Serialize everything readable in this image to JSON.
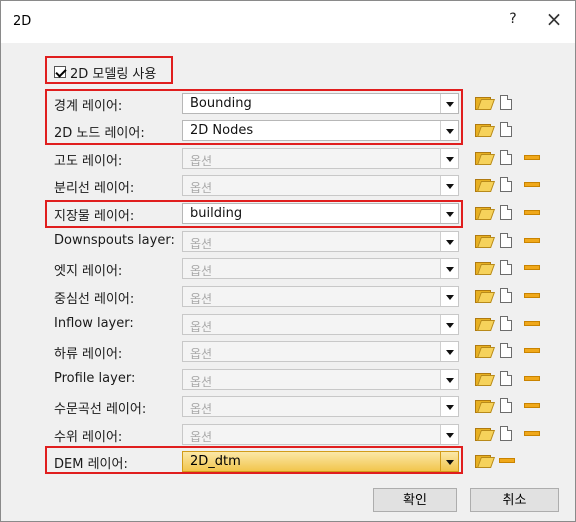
{
  "window": {
    "title": "2D",
    "help_glyph": "?",
    "close_glyph": "×"
  },
  "use_2d_modeling": {
    "label": "2D 모델링 사용",
    "checked": true
  },
  "layers": [
    {
      "label": "경계 레이어:",
      "value": "Bounding",
      "enabled": true,
      "icons": [
        "browse-icon",
        "new-layer-icon"
      ]
    },
    {
      "label": "2D 노드 레이어:",
      "value": "2D Nodes",
      "enabled": true,
      "icons": [
        "browse-icon",
        "new-layer-icon"
      ]
    },
    {
      "label": "고도 레이어:",
      "value": "옵션",
      "enabled": false,
      "icons": [
        "browse-icon",
        "new-layer-icon",
        "clear-icon"
      ]
    },
    {
      "label": "분리선 레이어:",
      "value": "옵션",
      "enabled": false,
      "icons": [
        "browse-icon",
        "new-layer-icon",
        "clear-icon"
      ]
    },
    {
      "label": "지장물 레이어:",
      "value": "building",
      "enabled": true,
      "icons": [
        "browse-icon",
        "new-layer-icon",
        "clear-icon"
      ]
    },
    {
      "label": "Downspouts layer:",
      "value": "옵션",
      "enabled": false,
      "icons": [
        "browse-icon",
        "new-layer-icon",
        "clear-icon"
      ]
    },
    {
      "label": "엣지 레이어:",
      "value": "옵션",
      "enabled": false,
      "icons": [
        "browse-icon",
        "new-layer-icon",
        "clear-icon"
      ]
    },
    {
      "label": "중심선 레이어:",
      "value": "옵션",
      "enabled": false,
      "icons": [
        "browse-icon",
        "new-layer-icon",
        "clear-icon"
      ]
    },
    {
      "label": "Inflow layer:",
      "value": "옵션",
      "enabled": false,
      "icons": [
        "browse-icon",
        "new-layer-icon",
        "clear-icon"
      ]
    },
    {
      "label": "하류 레이어:",
      "value": "옵션",
      "enabled": false,
      "icons": [
        "browse-icon",
        "new-layer-icon",
        "clear-icon"
      ]
    },
    {
      "label": "Profile layer:",
      "value": "옵션",
      "enabled": false,
      "icons": [
        "browse-icon",
        "new-layer-icon",
        "clear-icon"
      ]
    },
    {
      "label": "수문곡선 레이어:",
      "value": "옵션",
      "enabled": false,
      "icons": [
        "browse-icon",
        "new-layer-icon",
        "clear-icon"
      ]
    },
    {
      "label": "수위 레이어:",
      "value": "옵션",
      "enabled": false,
      "icons": [
        "browse-icon",
        "new-layer-icon",
        "clear-icon"
      ]
    },
    {
      "label": "DEM 레이어:",
      "value": "2D_dtm",
      "enabled": true,
      "selected": true,
      "icons": [
        "browse-icon",
        "clear-icon"
      ]
    }
  ],
  "buttons": {
    "ok": "확인",
    "cancel": "취소"
  },
  "colors": {
    "highlight": "#e01e1e",
    "selected_combo": "#f2c54d",
    "clear_icon": "#f0a81a",
    "browse_icon": "#e7b022"
  }
}
